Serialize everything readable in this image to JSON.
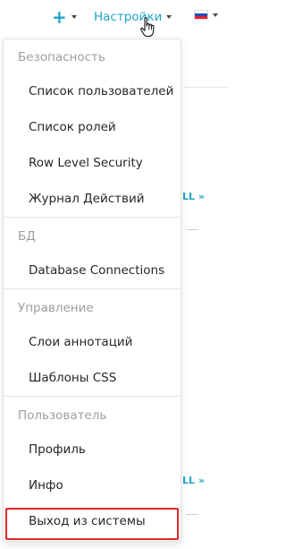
{
  "navbar": {
    "plus_icon": "+",
    "settings_label": "Настройки",
    "lang_flag": {
      "icon": "russia-flag-icon",
      "colors": [
        "#ffffff",
        "#1f4fb8",
        "#e3242b"
      ]
    },
    "accent_color": "#20a7c9"
  },
  "background": {
    "link_1": "LL »",
    "link_2": "LL »"
  },
  "dropdown": {
    "sections": [
      {
        "header": "Безопасность",
        "items": [
          "Список пользователей",
          "Список ролей",
          "Row Level Security",
          "Журнал Действий"
        ]
      },
      {
        "header": "БД",
        "items": [
          "Database Connections"
        ]
      },
      {
        "header": "Управление",
        "items": [
          "Слои аннотаций",
          "Шаблоны CSS"
        ]
      },
      {
        "header": "Пользователь",
        "items": [
          "Профиль",
          "Инфо",
          "Выход из системы"
        ]
      }
    ],
    "highlight_color": "#e3242b"
  }
}
